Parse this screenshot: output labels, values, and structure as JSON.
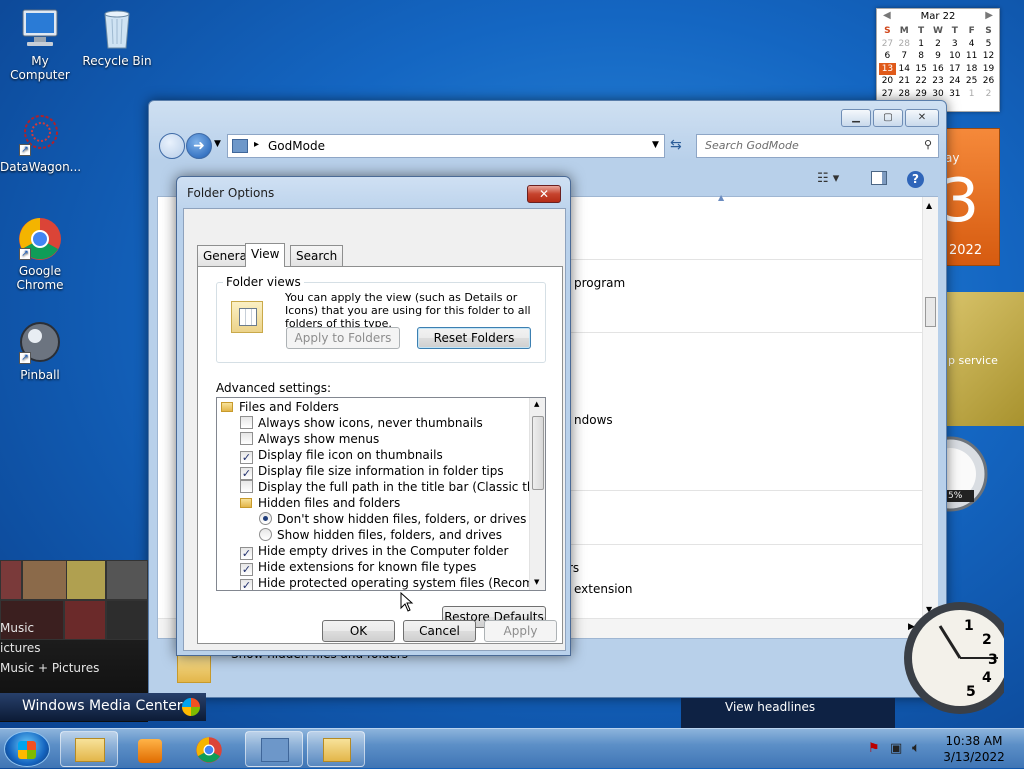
{
  "desktop": {
    "icons": [
      {
        "label": "My Computer"
      },
      {
        "label": "Recycle Bin"
      },
      {
        "label": "DataWagon..."
      },
      {
        "label": "Google Chrome"
      },
      {
        "label": "Pinball"
      }
    ]
  },
  "calendar": {
    "month_label": "Mar 22",
    "weekday_headers": [
      "S",
      "M",
      "T",
      "W",
      "T",
      "F",
      "S"
    ],
    "weeks": [
      [
        "27",
        "28",
        "1",
        "2",
        "3",
        "4",
        "5"
      ],
      [
        "6",
        "7",
        "8",
        "9",
        "10",
        "11",
        "12"
      ],
      [
        "13",
        "14",
        "15",
        "16",
        "17",
        "18",
        "19"
      ],
      [
        "20",
        "21",
        "22",
        "23",
        "24",
        "25",
        "26"
      ],
      [
        "27",
        "28",
        "29",
        "30",
        "31",
        "1",
        "2"
      ]
    ],
    "today": "13",
    "big_day_suffix": "ay",
    "big_day_number": "3",
    "big_day_year": "2022"
  },
  "gadgets": {
    "feed_text": "p service",
    "meter_text": "5%"
  },
  "explorer": {
    "address": "GodMode",
    "search_placeholder": "Search GodMode",
    "rows": [
      "program",
      "ndows",
      "rs",
      "extension"
    ],
    "behind_item": "Show hidden files and folders"
  },
  "media_center": {
    "labels": [
      "Music",
      "ictures",
      "Music + Pictures"
    ],
    "brand": "Windows Media Center",
    "headlines": "View headlines"
  },
  "taskbar": {
    "time": "10:38 AM",
    "date": "3/13/2022"
  },
  "dialog": {
    "title": "Folder Options",
    "close_glyph": "✕",
    "tabs": [
      "General",
      "View",
      "Search"
    ],
    "active_tab": "View",
    "folder_views": {
      "title": "Folder views",
      "description": "You can apply the view (such as Details or Icons) that you are using for this folder to all folders of this type.",
      "apply_button": "Apply to Folders",
      "reset_button": "Reset Folders"
    },
    "advanced_label": "Advanced settings:",
    "tree": [
      {
        "type": "folder",
        "label": "Files and Folders",
        "indent": 0
      },
      {
        "type": "check",
        "checked": false,
        "label": "Always show icons, never thumbnails",
        "indent": 1
      },
      {
        "type": "check",
        "checked": false,
        "label": "Always show menus",
        "indent": 1
      },
      {
        "type": "check",
        "checked": true,
        "label": "Display file icon on thumbnails",
        "indent": 1
      },
      {
        "type": "check",
        "checked": true,
        "label": "Display file size information in folder tips",
        "indent": 1
      },
      {
        "type": "check",
        "checked": false,
        "label": "Display the full path in the title bar (Classic theme only)",
        "indent": 1
      },
      {
        "type": "folder",
        "label": "Hidden files and folders",
        "indent": 1
      },
      {
        "type": "radio",
        "checked": true,
        "label": "Don't show hidden files, folders, or drives",
        "indent": 2
      },
      {
        "type": "radio",
        "checked": false,
        "label": "Show hidden files, folders, and drives",
        "indent": 2
      },
      {
        "type": "check",
        "checked": true,
        "label": "Hide empty drives in the Computer folder",
        "indent": 1
      },
      {
        "type": "check",
        "checked": true,
        "label": "Hide extensions for known file types",
        "indent": 1
      },
      {
        "type": "check",
        "checked": true,
        "label": "Hide protected operating system files (Recommended)",
        "indent": 1
      }
    ],
    "restore_defaults": "Restore Defaults",
    "ok": "OK",
    "cancel": "Cancel",
    "apply": "Apply"
  },
  "colors": {
    "desktop_blue": "#1466c2",
    "calendar_accent": "#e05a1a"
  }
}
